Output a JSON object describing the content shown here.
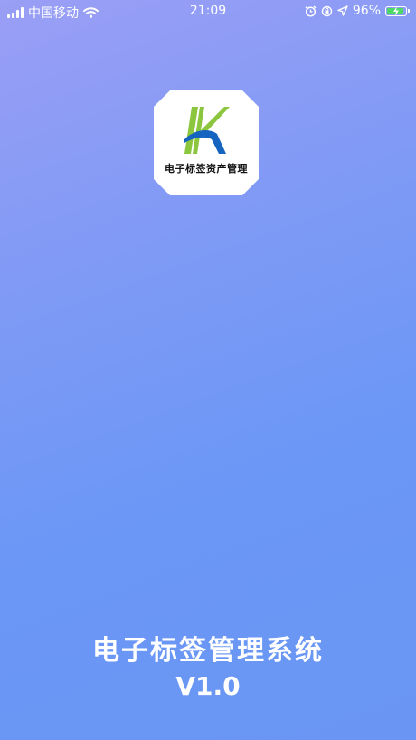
{
  "status_bar": {
    "carrier": "中国移动",
    "time": "21:09",
    "battery_percent": "96%",
    "battery_level": 0.96,
    "icons": [
      "signal-icon",
      "wifi-icon",
      "alarm-icon",
      "orientation-lock-icon",
      "location-icon",
      "battery-icon",
      "charging-icon"
    ]
  },
  "logo": {
    "text": "电子标签资产管理",
    "colors": {
      "green": "#8cc63f",
      "blue": "#1565c0"
    }
  },
  "splash": {
    "title": "电子标签管理系统",
    "version": "V1.0"
  },
  "colors": {
    "gradient_start": "#9a9ef5",
    "gradient_end": "#6a95f3",
    "text": "#ffffff"
  }
}
